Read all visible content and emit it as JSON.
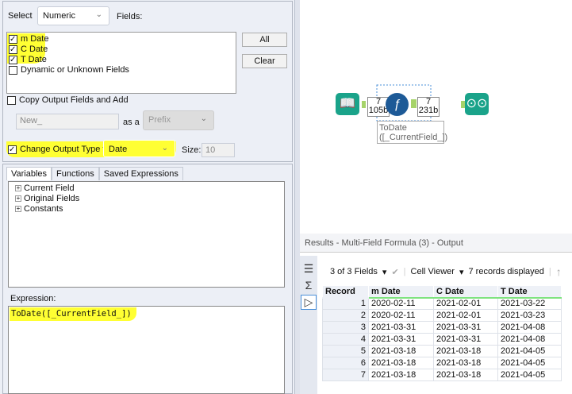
{
  "config": {
    "select_label": "Select",
    "select_value": "Numeric",
    "fields_label": "Fields:",
    "fields": [
      {
        "label": "m Date",
        "checked": true
      },
      {
        "label": "C Date",
        "checked": true
      },
      {
        "label": "T Date",
        "checked": true
      },
      {
        "label": "Dynamic or Unknown Fields",
        "checked": false
      }
    ],
    "all_button": "All",
    "clear_button": "Clear",
    "copy_output_label": "Copy Output Fields and Add",
    "copy_prefix_value": "New_",
    "as_a_label": "as a",
    "prefix_select": "Prefix",
    "change_type_label": "Change Output Type to",
    "change_type_value": "Date",
    "size_label": "Size:",
    "size_value": "10"
  },
  "tabs": [
    "Variables",
    "Functions",
    "Saved Expressions"
  ],
  "tree": [
    "Current Field",
    "Original Fields",
    "Constants"
  ],
  "expression_label": "Expression:",
  "expression": "ToDate([_CurrentField_])",
  "workflow": {
    "in_count": "7",
    "in_size": "105b",
    "out_count": "7",
    "out_size": "231b",
    "annotation_line1": "ToDate",
    "annotation_line2": "([_CurrentField_])"
  },
  "results": {
    "title": "Results - Multi-Field Formula (3) - Output",
    "fields_selector": "3 of 3 Fields",
    "viewer": "Cell Viewer",
    "records_displayed": "7 records displayed",
    "columns": [
      "Record",
      "m Date",
      "C Date",
      "T Date"
    ],
    "rows": [
      [
        "1",
        "2020-02-11",
        "2021-02-01",
        "2021-03-22"
      ],
      [
        "2",
        "2020-02-11",
        "2021-02-01",
        "2021-03-23"
      ],
      [
        "3",
        "2021-03-31",
        "2021-03-31",
        "2021-04-08"
      ],
      [
        "4",
        "2021-03-31",
        "2021-03-31",
        "2021-04-08"
      ],
      [
        "5",
        "2021-03-18",
        "2021-03-18",
        "2021-04-05"
      ],
      [
        "6",
        "2021-03-18",
        "2021-03-18",
        "2021-04-05"
      ],
      [
        "7",
        "2021-03-18",
        "2021-03-18",
        "2021-04-05"
      ]
    ]
  }
}
